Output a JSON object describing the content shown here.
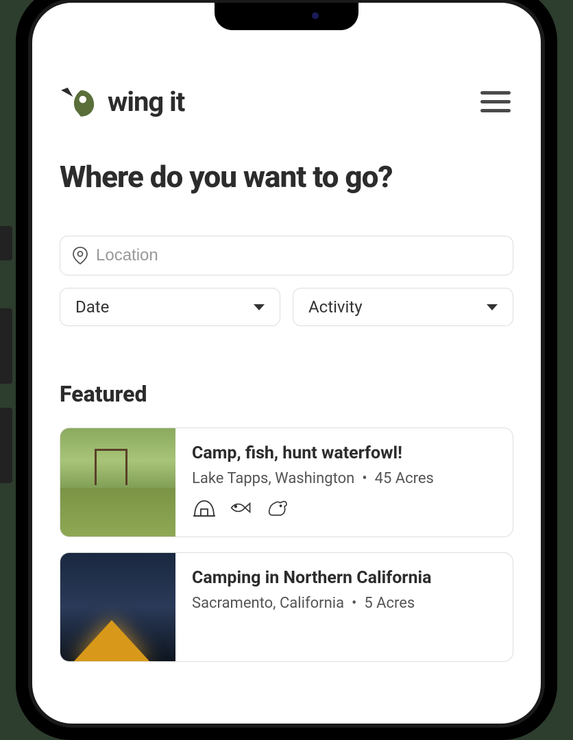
{
  "header": {
    "brand_name": "wing it"
  },
  "page": {
    "title": "Where do you want to go?"
  },
  "search": {
    "location_placeholder": "Location",
    "date_label": "Date",
    "activity_label": "Activity"
  },
  "featured": {
    "heading": "Featured",
    "items": [
      {
        "title": "Camp, fish, hunt waterfowl!",
        "location": "Lake Tapps, Washington",
        "acres": "45 Acres",
        "activities": [
          "camping",
          "fishing",
          "dog-friendly"
        ]
      },
      {
        "title": "Camping in Northern California",
        "location": "Sacramento, California",
        "acres": "5 Acres",
        "activities": []
      }
    ]
  }
}
